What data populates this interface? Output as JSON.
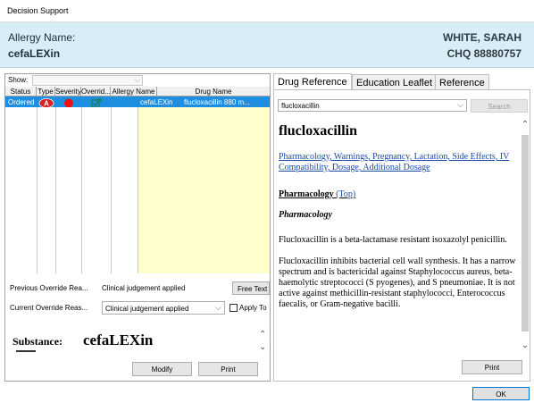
{
  "window": {
    "title": "Decision Support"
  },
  "header": {
    "allergy_label": "Allergy Name:",
    "allergy_value": "cefaLEXin",
    "patient_name": "WHITE, SARAH",
    "patient_mrn": "CHQ 88880757",
    "bg_color": "#d9edf6"
  },
  "left": {
    "show_label": "Show:",
    "show_value": "",
    "columns": [
      "Status",
      "Type",
      "Severity",
      "Overrid...",
      "Allergy Name",
      "Drug Name"
    ],
    "rows": [
      {
        "status": "Ordered",
        "type_icon": "allergy-a-icon",
        "type_letter": "A",
        "severity_icon": "red-dot-icon",
        "override_icon": "check-edit-icon",
        "allergy_name": "cefaLEXin",
        "drug_name": "flucloxacillin 880 m..."
      }
    ],
    "selected_row_color": "#1e8fe0",
    "previous_override_label": "Previous Override Rea...",
    "previous_override_value": "Clinical judgement applied",
    "free_text_label": "Free Text",
    "current_override_label": "Current Override Reas...",
    "current_override_value": "Clinical judgement applied",
    "apply_to_label": "Apply To",
    "substance_label": "Substance:",
    "substance_value": "cefaLEXin",
    "modify_label": "Modify",
    "print_label": "Print"
  },
  "right": {
    "tabs": [
      {
        "label": "Drug Reference",
        "active": true
      },
      {
        "label": "Education Leaflet",
        "active": false
      },
      {
        "label": "Reference",
        "active": false
      }
    ],
    "search_value": "flucloxacillin",
    "search_button": "Search",
    "article": {
      "title": "flucloxacillin",
      "links": "Pharmacology, Warnings, Pregnancy, Lactation, Side Effects, IV Compatibility, Dosage, Additional Dosage",
      "section_title": "Pharmacology",
      "section_top": "(Top)",
      "subheading": "Pharmacology",
      "para1": "Flucloxacillin is a beta-lactamase resistant isoxazolyl penicillin.",
      "para2": "Flucloxacillin inhibits bacterial cell wall synthesis. It has a narrow spectrum and is bactericidal against Staphylococcus aureus, beta-haemolytic streptococci (S pyogenes), and S pneumoniae. It is not active against methicillin-resistant staphylococci, Enterococcus faecalis, or Gram-negative bacilli."
    },
    "print_label": "Print"
  },
  "footer": {
    "ok_label": "OK"
  }
}
